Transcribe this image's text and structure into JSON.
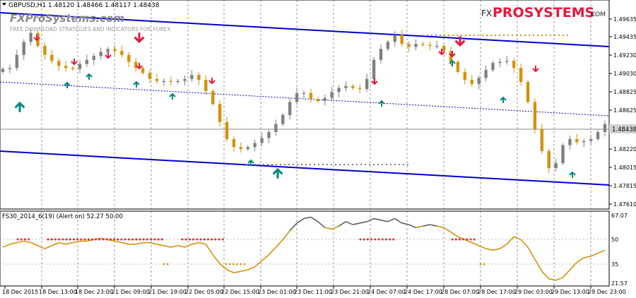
{
  "header": {
    "symbol_info": "GBPUSD,H1  1.48120 1.48466 1.48117 1.48438",
    "watermark_title": "FXProSystems.com",
    "watermark_subtitle": "FREE DOWNLOAD STRATEGIES AND INDICATORS FOR FOREX"
  },
  "brand": {
    "prefix": "FX",
    "name": "PROSYSTEMS",
    "suffix": ".COM"
  },
  "indicator": {
    "label": "FS30_2014_6(19) (Alert on) 52.27 50.00"
  },
  "price_axis": {
    "labels": [
      "1.49635",
      "1.49435",
      "1.49230",
      "1.49030",
      "1.48825",
      "1.48625",
      "1.48438",
      "1.48220",
      "1.48015",
      "1.47815",
      "1.47610"
    ],
    "current_price": "1.48438"
  },
  "indicator_axis": {
    "labels": [
      "67.07",
      "50",
      "35",
      "21.57"
    ]
  },
  "time_axis": {
    "labels": [
      "18 Dec 2015",
      "18 Dec 13:00",
      "18 Dec 23:00",
      "21 Dec 09:00",
      "21 Dec 19:00",
      "22 Dec 05:00",
      "22 Dec 15:00",
      "23 Dec 01:00",
      "23 Dec 11:00",
      "23 Dec 21:00",
      "24 Dec 07:00",
      "24 Dec 17:00",
      "28 Dec 07:00",
      "28 Dec 17:00",
      "29 Dec 03:00",
      "29 Dec 13:00",
      "29 Dec 23:00"
    ]
  },
  "colors": {
    "bull_candle": "#808080",
    "bear_candle": "#d4920a",
    "channel": "#0000cc",
    "sell_arrow": "#e8173c",
    "buy_arrow": "#00897b",
    "indicator_line_low": "#d4920a",
    "indicator_line_high": "#606060",
    "signal_dots": "#ff2020"
  },
  "chart_data": {
    "type": "candlestick",
    "symbol": "GBPUSD",
    "timeframe": "H1",
    "ohlc_header": {
      "open": 1.4812,
      "high": 1.48466,
      "low": 1.48117,
      "close": 1.48438
    },
    "close_path": [
      1.4898,
      1.4899,
      1.4912,
      1.4925,
      1.4934,
      1.4921,
      1.4912,
      1.4906,
      1.4901,
      1.4899,
      1.4898,
      1.4903,
      1.4907,
      1.4911,
      1.4915,
      1.4918,
      1.4916,
      1.4912,
      1.4905,
      1.4899,
      1.4894,
      1.4888,
      1.4886,
      1.4886,
      1.4885,
      1.4886,
      1.4888,
      1.4892,
      1.4887,
      1.4876,
      1.4863,
      1.4845,
      1.4828,
      1.482,
      1.4818,
      1.482,
      1.4824,
      1.4829,
      1.4835,
      1.4843,
      1.4852,
      1.4865,
      1.4874,
      1.4874,
      1.4868,
      1.4866,
      1.4869,
      1.4875,
      1.4879,
      1.4881,
      1.4879,
      1.4878,
      1.4888,
      1.4907,
      1.4918,
      1.4925,
      1.4932,
      1.4923,
      1.492,
      1.4923,
      1.4922,
      1.4921,
      1.4921,
      1.4916,
      1.4905,
      1.4895,
      1.4887,
      1.4883,
      1.4889,
      1.4897,
      1.4904,
      1.4905,
      1.4906,
      1.4899,
      1.4885,
      1.4865,
      1.4838,
      1.4816,
      1.4799,
      1.4804,
      1.4822,
      1.4828,
      1.4825,
      1.4826,
      1.4828,
      1.4835,
      1.4843
    ],
    "indicator_series": [
      45,
      47,
      48,
      49,
      48,
      46,
      44,
      46,
      48,
      47,
      48,
      49,
      49,
      50,
      51,
      50,
      49,
      48,
      47,
      47,
      48,
      48,
      47,
      46,
      45,
      46,
      45,
      47,
      48,
      47,
      40,
      34,
      30,
      28,
      29,
      30,
      32,
      36,
      40,
      45,
      50,
      56,
      61,
      64,
      65,
      62,
      58,
      57,
      59,
      62,
      60,
      61,
      62,
      64,
      63,
      62,
      64,
      61,
      60,
      58,
      59,
      60,
      59,
      58,
      55,
      52,
      50,
      48,
      46,
      44,
      43,
      44,
      47,
      52,
      50,
      45,
      37,
      29,
      24,
      23,
      25,
      30,
      35,
      38,
      39,
      41,
      43
    ],
    "channel_lines": [
      "upper",
      "middle",
      "lower"
    ],
    "ylim": [
      1.4761,
      1.4964
    ],
    "indicator_ylim": [
      21.57,
      67.07
    ],
    "indicator_levels": [
      50,
      35
    ]
  }
}
